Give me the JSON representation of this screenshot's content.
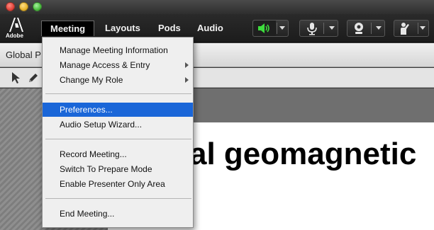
{
  "app": {
    "brand": "Adobe",
    "menubar": {
      "meeting": "Meeting",
      "layouts": "Layouts",
      "pods": "Pods",
      "audio": "Audio"
    },
    "controls": {
      "speaker_icon": "speaker-icon",
      "mic_icon": "microphone-icon",
      "camera_icon": "webcam-icon",
      "hand_icon": "raise-hand-icon",
      "speaker_color": "#3ddc3d"
    }
  },
  "pod": {
    "title": "Global P",
    "slide_text": "al geomagnetic"
  },
  "meeting_menu": {
    "items": [
      {
        "label": "Manage Meeting Information"
      },
      {
        "label": "Manage Access & Entry"
      },
      {
        "label": "Change My Role"
      },
      {
        "label": "Preferences..."
      },
      {
        "label": "Audio Setup Wizard..."
      },
      {
        "label": "Record Meeting..."
      },
      {
        "label": "Switch To Prepare Mode"
      },
      {
        "label": "Enable Presenter Only Area"
      },
      {
        "label": "End Meeting..."
      }
    ],
    "highlight_color": "#1a66d8"
  }
}
